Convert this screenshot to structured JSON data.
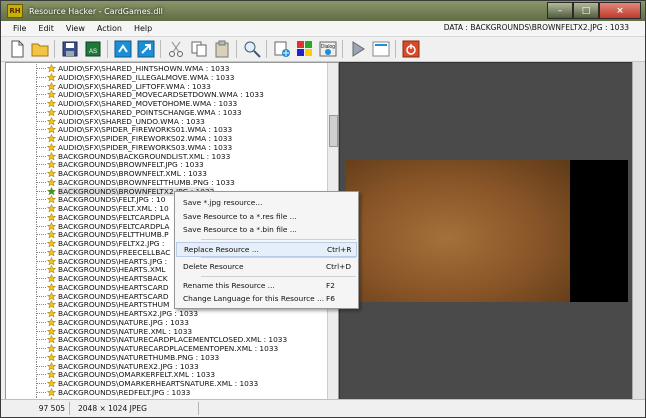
{
  "window": {
    "app_icon_text": "RH",
    "title": "Resource Hacker - CardGames.dll",
    "controls": {
      "minimize": "–",
      "maximize": "□",
      "close": "×"
    }
  },
  "menu": {
    "items": [
      "File",
      "Edit",
      "View",
      "Action",
      "Help"
    ],
    "status": "DATA : BACKGROUNDS\\BROWNFELTX2.JPG : 1033"
  },
  "toolbar": {
    "buttons": [
      {
        "name": "new-icon"
      },
      {
        "name": "open-folder-icon"
      },
      {
        "name": "save-icon"
      },
      {
        "name": "save-as-icon",
        "text": "AS"
      },
      {
        "name": "compile-icon"
      },
      {
        "name": "run-arrow-icon"
      },
      {
        "name": "cut-icon"
      },
      {
        "name": "copy-icon"
      },
      {
        "name": "paste-icon"
      },
      {
        "name": "find-icon"
      },
      {
        "name": "add-resource-icon"
      },
      {
        "name": "add-image-icon"
      },
      {
        "name": "dialog-merger-icon",
        "text": "Dialog"
      },
      {
        "name": "play-icon"
      },
      {
        "name": "show-icon"
      },
      {
        "name": "power-icon"
      }
    ]
  },
  "tree": {
    "rows": [
      "AUDIO\\SFX\\SHARED_HINTSHOWN.WMA : 1033",
      "AUDIO\\SFX\\SHARED_ILLEGALMOVE.WMA : 1033",
      "AUDIO\\SFX\\SHARED_LIFTOFF.WMA : 1033",
      "AUDIO\\SFX\\SHARED_MOVECARDSETDOWN.WMA : 1033",
      "AUDIO\\SFX\\SHARED_MOVETOHOME.WMA : 1033",
      "AUDIO\\SFX\\SHARED_POINTSCHANGE.WMA : 1033",
      "AUDIO\\SFX\\SHARED_UNDO.WMA : 1033",
      "AUDIO\\SFX\\SPIDER_FIREWORKS01.WMA : 1033",
      "AUDIO\\SFX\\SPIDER_FIREWORKS02.WMA : 1033",
      "AUDIO\\SFX\\SPIDER_FIREWORKS03.WMA : 1033",
      "BACKGROUNDS\\BACKGROUNDLIST.XML : 1033",
      "BACKGROUNDS\\BROWNFELT.JPG : 1033",
      "BACKGROUNDS\\BROWNFELT.XML : 1033",
      "BACKGROUNDS\\BROWNFELTTHUMB.PNG : 1033",
      "BACKGROUNDS\\BROWNFELTX2.JPG : 1033",
      "BACKGROUNDS\\FELT.JPG : 10",
      "BACKGROUNDS\\FELT.XML : 10",
      "BACKGROUNDS\\FELTCARDPLA",
      "BACKGROUNDS\\FELTCARDPLA",
      "BACKGROUNDS\\FELTTHUMB.P",
      "BACKGROUNDS\\FELTX2.JPG :",
      "BACKGROUNDS\\FREECELLBAC",
      "BACKGROUNDS\\HEARTS.JPG :",
      "BACKGROUNDS\\HEARTS.XML",
      "BACKGROUNDS\\HEARTSBACK",
      "BACKGROUNDS\\HEARTSCARD",
      "BACKGROUNDS\\HEARTSCARD",
      "BACKGROUNDS\\HEARTSTHUM",
      "BACKGROUNDS\\HEARTSX2.JPG : 1033",
      "BACKGROUNDS\\NATURE.JPG : 1033",
      "BACKGROUNDS\\NATURE.XML : 1033",
      "BACKGROUNDS\\NATURECARDPLACEMENTCLOSED.XML : 1033",
      "BACKGROUNDS\\NATURECARDPLACEMENTOPEN.XML : 1033",
      "BACKGROUNDS\\NATURETHUMB.PNG : 1033",
      "BACKGROUNDS\\NATUREX2.JPG : 1033",
      "BACKGROUNDS\\OMARKERFELT.XML : 1033",
      "BACKGROUNDS\\OMARKERHEARTSNATURE.XML : 1033",
      "BACKGROUNDS\\REDFELT.JPG : 1033",
      "BACKGROUNDS\\REDFELT.XML : 1033"
    ],
    "selected_index": 14
  },
  "context_menu": {
    "items": [
      {
        "label": "Save *.jpg resource...",
        "shortcut": ""
      },
      {
        "label": "Save Resource to a *.res file ...",
        "shortcut": ""
      },
      {
        "label": "Save Resource to a *.bin file ...",
        "shortcut": ""
      },
      {
        "separator": true
      },
      {
        "label": "Replace Resource ...",
        "shortcut": "Ctrl+R",
        "highlight": true
      },
      {
        "separator": true
      },
      {
        "label": "Delete Resource",
        "shortcut": "Ctrl+D"
      },
      {
        "separator": true
      },
      {
        "label": "Rename this Resource ...",
        "shortcut": "F2"
      },
      {
        "label": "Change Language for this Resource ...",
        "shortcut": "F6"
      }
    ]
  },
  "statusbar": {
    "position": "97 505",
    "image_info": "2048 × 1024  JPEG"
  },
  "colors": {
    "star_green": "#2e9e2e",
    "star_yellow": "#f2c21a",
    "felt_brown": "#8a5628",
    "preview_bg": "#4a4a4a"
  }
}
